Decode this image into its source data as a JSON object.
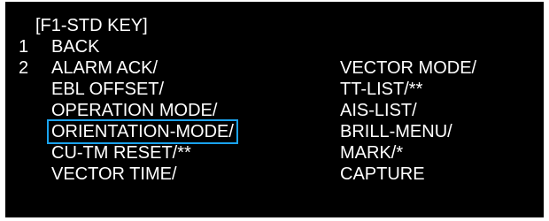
{
  "menu": {
    "title": "[F1-STD KEY]",
    "items": [
      {
        "number": "1",
        "label": "BACK"
      },
      {
        "number": "2",
        "label": "ALARM ACK/"
      }
    ],
    "column1_options": [
      "EBL OFFSET/",
      "OPERATION MODE/",
      "ORIENTATION-MODE/",
      "CU-TM RESET/**",
      "VECTOR TIME/"
    ],
    "column2_options": [
      "VECTOR MODE/",
      "TT-LIST/**",
      "AIS-LIST/",
      "BRILL-MENU/",
      "MARK/*",
      "CAPTURE"
    ],
    "selected_option": "ORIENTATION-MODE/",
    "highlight_color": "#1aa3ee"
  }
}
